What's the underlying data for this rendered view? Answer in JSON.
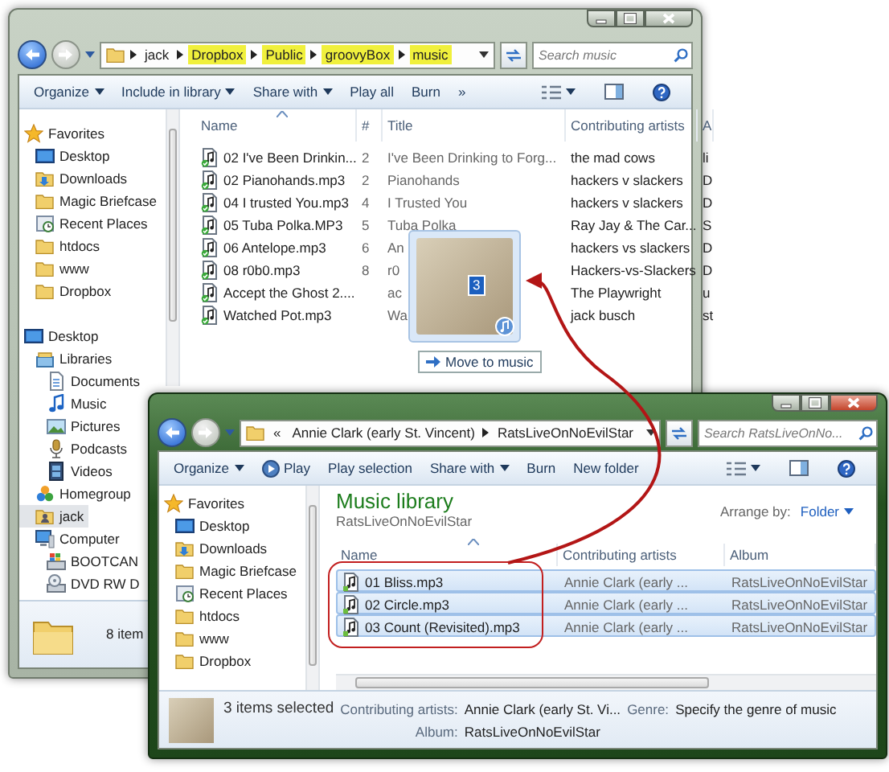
{
  "back_window": {
    "address_bar": {
      "path": [
        {
          "label": "jack",
          "highlighted": false
        },
        {
          "label": "Dropbox",
          "highlighted": true
        },
        {
          "label": "Public",
          "highlighted": true
        },
        {
          "label": "groovyBox",
          "highlighted": true
        },
        {
          "label": "music",
          "highlighted": true
        }
      ],
      "search_placeholder": "Search music"
    },
    "toolbar": [
      {
        "label": "Organize",
        "kind": "menu"
      },
      {
        "label": "Include in library",
        "kind": "menu"
      },
      {
        "label": "Share with",
        "kind": "menu"
      },
      {
        "label": "Play all",
        "kind": "command"
      },
      {
        "label": "Burn",
        "kind": "command"
      },
      {
        "label": "»",
        "kind": "command"
      }
    ],
    "sidebar": [
      {
        "label": "Favorites",
        "kind": "star",
        "selected": false,
        "children": [
          {
            "label": "Desktop",
            "kind": "desktop",
            "selected": false
          },
          {
            "label": "Downloads",
            "kind": "downloads",
            "selected": false
          },
          {
            "label": "Magic Briefcase",
            "kind": "folder",
            "selected": false
          },
          {
            "label": "Recent Places",
            "kind": "recent",
            "selected": false
          },
          {
            "label": "htdocs",
            "kind": "folder",
            "selected": false
          },
          {
            "label": "www",
            "kind": "folder",
            "selected": false
          },
          {
            "label": "Dropbox",
            "kind": "folder",
            "selected": false
          }
        ]
      },
      {
        "label": "Desktop",
        "kind": "desktop",
        "selected": false,
        "children": [
          {
            "label": "Libraries",
            "kind": "library",
            "selected": false,
            "children": [
              {
                "label": "Documents",
                "kind": "document",
                "selected": false
              },
              {
                "label": "Music",
                "kind": "music",
                "selected": false
              },
              {
                "label": "Pictures",
                "kind": "picture",
                "selected": false
              },
              {
                "label": "Podcasts",
                "kind": "podcast",
                "selected": false
              },
              {
                "label": "Videos",
                "kind": "video",
                "selected": false
              }
            ]
          },
          {
            "label": "Homegroup",
            "kind": "homegroup",
            "selected": false
          },
          {
            "label": "jack",
            "kind": "user",
            "selected": true
          },
          {
            "label": "Computer",
            "kind": "computer",
            "selected": false,
            "children": [
              {
                "label": "BOOTCAN",
                "kind": "drive",
                "selected": false
              },
              {
                "label": "DVD RW D",
                "kind": "disc",
                "selected": false
              }
            ]
          }
        ]
      }
    ],
    "table": {
      "columns": [
        "Name",
        "#",
        "Title",
        "Contributing artists",
        "A"
      ],
      "rows": [
        {
          "name": "02 I've Been Drinkin...",
          "number": "2",
          "title": "I've Been Drinking to Forg...",
          "artists": "the mad cows",
          "column_5": "li"
        },
        {
          "name": "02 Pianohands.mp3",
          "number": "2",
          "title": "Pianohands",
          "artists": "hackers v slackers",
          "column_5": "D"
        },
        {
          "name": "04 I trusted You.mp3",
          "number": "4",
          "title": "I Trusted You",
          "artists": "hackers v slackers",
          "column_5": "D"
        },
        {
          "name": "05 Tuba Polka.MP3",
          "number": "5",
          "title": "Tuba Polka",
          "artists": "Ray Jay & The Car...",
          "column_5": "S"
        },
        {
          "name": "06 Antelope.mp3",
          "number": "6",
          "title": "An",
          "artists": "hackers vs slackers",
          "column_5": "D"
        },
        {
          "name": "08 r0b0.mp3",
          "number": "8",
          "title": "r0",
          "artists": "Hackers-vs-Slackers",
          "column_5": "D"
        },
        {
          "name": "Accept the Ghost 2....",
          "title": "ac",
          "artists": "The Playwright",
          "column_5": "u"
        },
        {
          "name": "Watched Pot.mp3",
          "title": "Wa",
          "artists": "jack busch",
          "column_5": "st"
        }
      ]
    },
    "drag_preview": {
      "count": "3",
      "tooltip": "Move to music"
    },
    "status_bar": "8 item"
  },
  "front_window": {
    "address_bar": {
      "overflow": "«",
      "path": [
        {
          "label": "Annie Clark (early St. Vincent)"
        },
        {
          "label": "RatsLiveOnNoEvilStar"
        }
      ],
      "search_placeholder": "Search RatsLiveOnNo..."
    },
    "toolbar": [
      {
        "label": "Organize",
        "kind": "menu"
      },
      {
        "label": "Play",
        "kind": "play"
      },
      {
        "label": "Play selection",
        "kind": "command"
      },
      {
        "label": "Share with",
        "kind": "menu"
      },
      {
        "label": "Burn",
        "kind": "command"
      },
      {
        "label": "New folder",
        "kind": "command"
      }
    ],
    "sidebar": [
      {
        "label": "Favorites",
        "kind": "star",
        "selected": false,
        "children": [
          {
            "label": "Desktop",
            "kind": "desktop",
            "selected": false
          },
          {
            "label": "Downloads",
            "kind": "downloads",
            "selected": false
          },
          {
            "label": "Magic Briefcase",
            "kind": "folder",
            "selected": false
          },
          {
            "label": "Recent Places",
            "kind": "recent",
            "selected": false
          },
          {
            "label": "htdocs",
            "kind": "folder",
            "selected": false
          },
          {
            "label": "www",
            "kind": "folder",
            "selected": false
          },
          {
            "label": "Dropbox",
            "kind": "folder",
            "selected": false
          }
        ]
      }
    ],
    "library": {
      "title": "Music library",
      "subtitle": "RatsLiveOnNoEvilStar",
      "arrange_label": "Arrange by:",
      "arrange_value": "Folder"
    },
    "table": {
      "columns": [
        "Name",
        "Contributing artists",
        "Album"
      ],
      "rows": [
        {
          "name": "01 Bliss.mp3",
          "artists": "Annie Clark (early ...",
          "album": "RatsLiveOnNoEvilStar",
          "selected": true
        },
        {
          "name": "02 Circle.mp3",
          "artists": "Annie Clark (early ...",
          "album": "RatsLiveOnNoEvilStar",
          "selected": true
        },
        {
          "name": "03 Count (Revisited).mp3",
          "artists": "Annie Clark (early ...",
          "album": "RatsLiveOnNoEvilStar",
          "selected": true
        }
      ]
    },
    "details": {
      "summary": "3 items selected",
      "fields": [
        {
          "label": "Contributing artists:",
          "value": "Annie Clark (early St. Vi..."
        },
        {
          "label": "Genre:",
          "value": "Specify the genre of music"
        },
        {
          "label": "Album:",
          "value": "RatsLiveOnNoEvilStar"
        }
      ]
    }
  }
}
